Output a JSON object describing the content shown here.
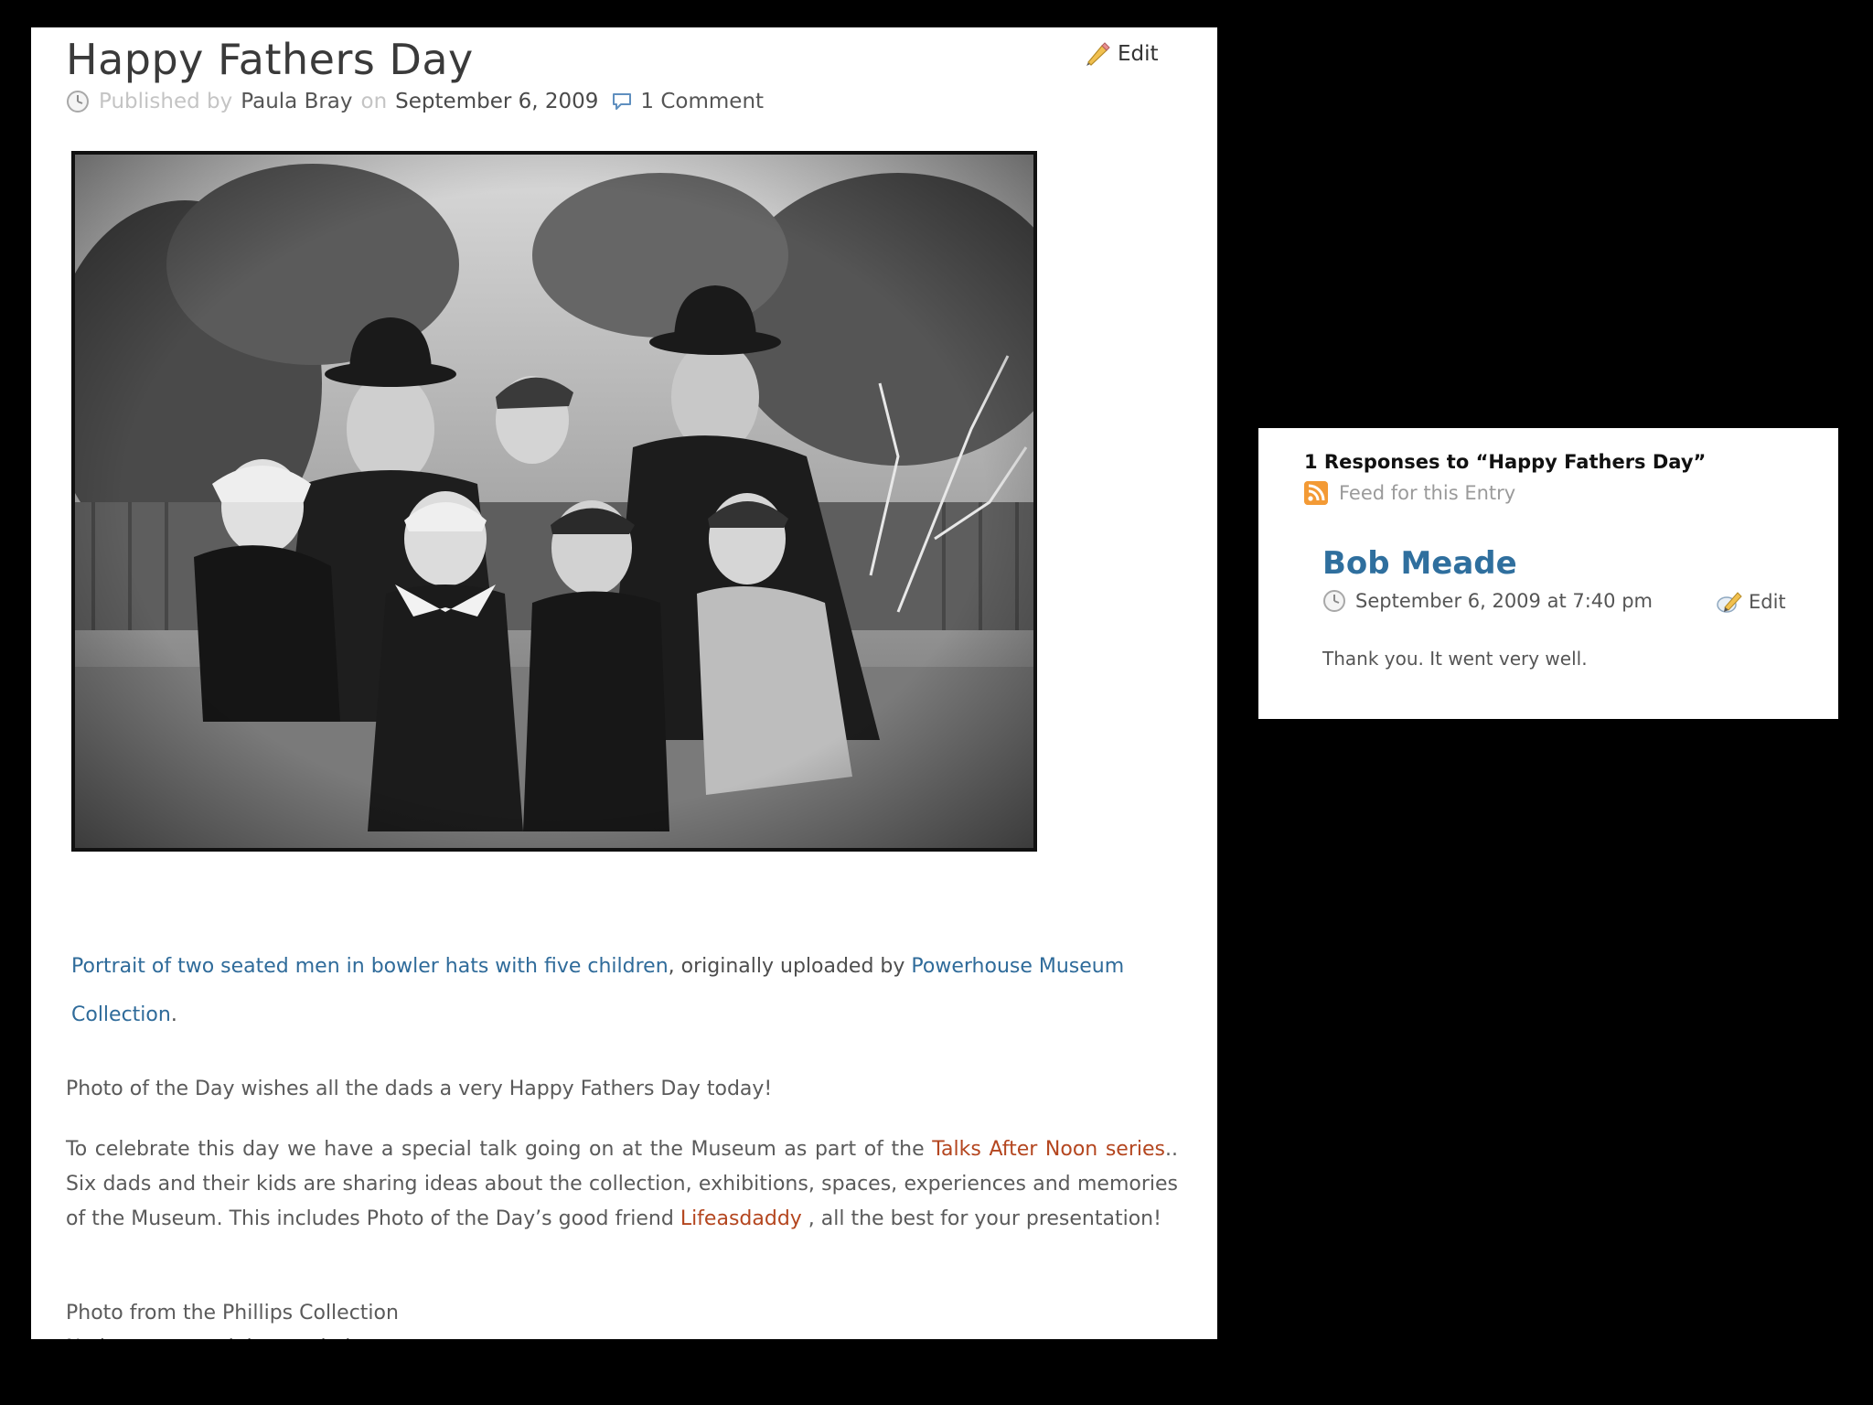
{
  "post": {
    "title": "Happy Fathers Day",
    "edit_label": "Edit",
    "meta": {
      "published_by": "Published by",
      "author": "Paula Bray",
      "on": "on",
      "date": "September 6, 2009",
      "comments": "1 Comment"
    },
    "photo_alt": "Portrait of two seated men in bowler hats with five children",
    "caption": {
      "link_text": "Portrait of two seated men in bowler hats with five children",
      "middle": ", originally uploaded by ",
      "uploader": "Powerhouse Museum Collection",
      "end": "."
    },
    "paragraph1": "Photo of the Day wishes all the dads a very Happy Fathers Day today!",
    "paragraph2": {
      "before": "To celebrate this day we have a special talk going on at the Museum as part of the ",
      "link1": "Talks After Noon series",
      "middle": ".. Six dads and their kids are sharing ideas about the collection, exhibitions, spaces, experiences and memories of the Museum. This includes Photo of the Day’s good friend ",
      "link2": "Lifeasdaddy",
      "after": " , all the best for your presentation!"
    },
    "credit_line1": "Photo from the Phillips Collection",
    "credit_line2": "No known copyright restrictions"
  },
  "comments": {
    "heading": "1 Responses to “Happy Fathers Day”",
    "feed_label": "Feed for this Entry",
    "items": [
      {
        "author": "Bob Meade",
        "datetime": "September 6, 2009 at 7:40 pm",
        "edit_label": "Edit",
        "text": "Thank you. It went very well."
      }
    ]
  },
  "icons": {
    "post_edit": "pencil-icon",
    "post_date": "clock-icon",
    "comments": "speech-bubble-icon",
    "feed": "rss-icon",
    "comment_date": "clock-icon",
    "comment_edit": "edit-note-icon"
  },
  "colors": {
    "link_blue": "#2f6b9a",
    "link_red": "#b4461f",
    "author_blue": "#2f6f9e",
    "rss_orange": "#f39a35"
  }
}
